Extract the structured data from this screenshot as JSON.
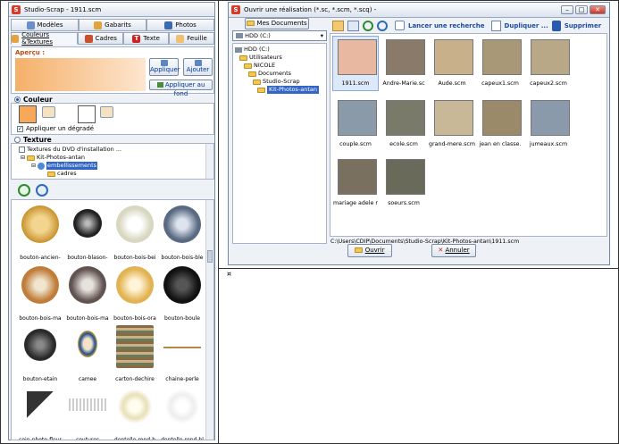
{
  "studio": {
    "title": "Studio-Scrap - 1911.scm",
    "tabs1": [
      "Modèles",
      "Gabarits",
      "Photos"
    ],
    "tabs2": [
      "Couleurs &Textures",
      "Cadres",
      "Texte",
      "Feuille"
    ],
    "apercu": "Aperçu :",
    "btn_appliquer": "Appliquer",
    "btn_ajouter": "Ajouter",
    "btn_appliquer_fond": "Appliquer au fond",
    "couleur": "Couleur",
    "appliquer_degrade": "Appliquer un dégradé",
    "texture": "Texture",
    "tree": [
      "Textures du DVD d'installation ...",
      "Kit-Photos-antan",
      "embellissements",
      "cadres"
    ],
    "items": [
      "bouton-ancien-",
      "bouton-blason-",
      "bouton-bois-bei",
      "bouton-bois-ble",
      "bouton-bois-ma",
      "bouton-bois-ma",
      "bouton-bois-ora",
      "bouton-boule",
      "bouton-etain",
      "camee",
      "carton-dechire",
      "chaine-perle",
      "coin-photo-fleur",
      "coutures",
      "dentelle-rond-b",
      "dentelle-rond-bl"
    ]
  },
  "dialog": {
    "title": "Ouvrir une réalisation (*.sc, *.scm, *.scq) -",
    "mes_documents": "Mes Documents",
    "drive": "HDD (C:)",
    "folders": [
      "HDD (C:)",
      "Utilisateurs",
      "NICOLE",
      "Documents",
      "Studio-Scrap",
      "Kit-Photos-antan"
    ],
    "toolbar": {
      "search": "Lancer une recherche",
      "duplicate": "Dupliquer ...",
      "delete": "Supprimer"
    },
    "files": [
      "1911.scm",
      "Andre-Marie.sc",
      "Aude.scm",
      "capeux1.scm",
      "capeux2.scm",
      "couple.scm",
      "ecole.scm",
      "grand-mere.scm",
      "jean en classe.",
      "jumeaux.scm",
      "mariage adele r",
      "soeurs.scm"
    ],
    "path": "C:\\Users\\CDIP\\Documents\\Studio-Scrap\\Kit-Photos-antan\\1911.scm",
    "btn_open": "Ouvrir",
    "btn_cancel": "Annuler"
  },
  "marker": "¤"
}
